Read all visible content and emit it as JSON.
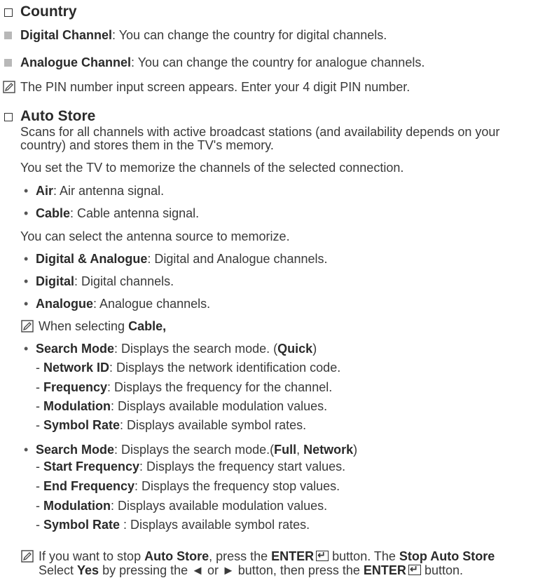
{
  "country": {
    "heading": "Country",
    "digital_term": "Digital Channel",
    "digital_desc": ": You can change the country for digital channels.",
    "analogue_term": "Analogue Channel",
    "analogue_desc": ": You can change the country for analogue channels.",
    "pin_note": "The PIN number input screen appears. Enter your 4 digit PIN number."
  },
  "auto_store": {
    "heading": "Auto Store",
    "desc_line1": "Scans for all channels with active broadcast stations (and availability depends on your",
    "desc_line2": "country) and stores them in the TV's memory.",
    "connection_intro": "You set the TV to memorize the channels of the selected connection.",
    "connections": [
      {
        "term": "Air",
        "desc": ": Air antenna signal."
      },
      {
        "term": "Cable",
        "desc": ": Cable antenna signal."
      }
    ],
    "source_intro": "You can select the antenna source to memorize.",
    "sources": [
      {
        "term": "Digital & Analogue",
        "desc": ": Digital and Analogue channels."
      },
      {
        "term": "Digital",
        "desc": ": Digital channels."
      },
      {
        "term": "Analogue",
        "desc": ": Analogue channels."
      }
    ],
    "cable_note_prefix": "When selecting ",
    "cable_note_term": "Cable,",
    "quick_mode": {
      "term": "Search Mode",
      "desc": ": Displays the search mode. (",
      "mode": "Quick",
      "close": ")",
      "items": [
        {
          "term": "Network ID",
          "desc": ": Displays the network identification code."
        },
        {
          "term": "Frequency",
          "desc": ": Displays the frequency for the channel."
        },
        {
          "term": "Modulation",
          "desc": ": Displays available modulation values."
        },
        {
          "term": "Symbol Rate",
          "desc": ": Displays available symbol rates."
        }
      ]
    },
    "full_mode": {
      "term": "Search Mode",
      "desc": ": Displays the search mode.(",
      "mode1": "Full",
      "sep": ", ",
      "mode2": "Network",
      "close": ")",
      "items": [
        {
          "term": "Start Frequency",
          "desc": ": Displays the frequency start values."
        },
        {
          "term": "End Frequency",
          "desc": ": Displays the frequency stop values."
        },
        {
          "term": "Modulation",
          "desc": ": Displays available modulation values."
        },
        {
          "term": "Symbol Rate",
          "desc": " : Displays available symbol rates."
        }
      ]
    },
    "stop_note": {
      "t1": "If you want to stop ",
      "b1": "Auto Store",
      "t2": ", press the ",
      "b2": "ENTER",
      "t3": " button. The ",
      "b3": "Stop Auto Store",
      "t4": "Select ",
      "b4": "Yes",
      "t5": " by pressing the ◄ or ► button, then press the ",
      "b5": "ENTER",
      "t6": " button."
    }
  }
}
